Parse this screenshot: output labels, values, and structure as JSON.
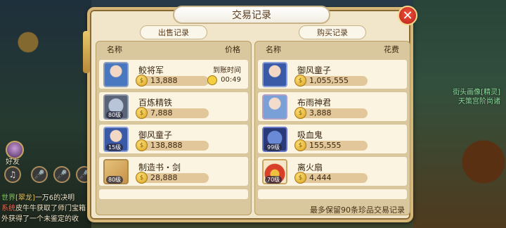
{
  "dialog": {
    "title": "交易记录",
    "footer_note": "最多保留90条珍品交易记录"
  },
  "sell": {
    "tab_label": "出售记录",
    "col_name": "名称",
    "col_price": "价格",
    "arrive_label": "到账时间",
    "items": [
      {
        "name": "鲛将军",
        "price": "13,888",
        "arrive_time": "00:49",
        "icon": "portrait-icon"
      },
      {
        "name": "百炼精铁",
        "price": "7,888",
        "level": "80级",
        "icon": "ore-icon"
      },
      {
        "name": "御风童子",
        "price": "138,888",
        "level": "15级",
        "icon": "portrait-icon"
      },
      {
        "name": "制造书・剑",
        "price": "28,888",
        "level": "80级",
        "icon": "scroll-icon"
      }
    ]
  },
  "buy": {
    "tab_label": "购买记录",
    "col_name": "名称",
    "col_cost": "花费",
    "items": [
      {
        "name": "御风童子",
        "price": "1,055,555",
        "icon": "portrait-icon"
      },
      {
        "name": "布雨神君",
        "price": "3,888",
        "icon": "portrait-icon"
      },
      {
        "name": "吸血鬼",
        "price": "155,555",
        "level": "99级",
        "icon": "beast-icon"
      },
      {
        "name": "离火扇",
        "price": "4,444",
        "level": "70级",
        "icon": "fan-icon"
      }
    ]
  },
  "hud": {
    "friend_label": "好友",
    "chat": [
      {
        "tag": "世界",
        "name": "[翠龙]",
        "text": "一万6的决明"
      },
      {
        "tag": "系统",
        "text": "皮牛牛获取了师门宝箱"
      },
      {
        "text": "外获得了一个未鉴定的收"
      }
    ],
    "npc_line1": "街头画像[精灵]",
    "npc_line2": "天策宫阶尚诸"
  }
}
